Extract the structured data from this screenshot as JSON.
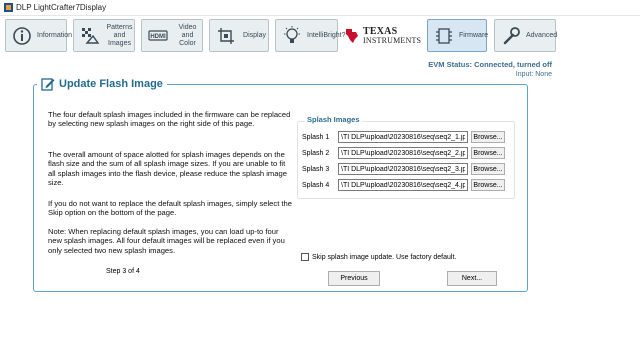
{
  "window": {
    "title": "DLP LightCrafter7Display"
  },
  "toolbar": {
    "information": "Information",
    "patterns": "Patterns and Images",
    "video": "Video and Color",
    "display": "Display",
    "intellibright": "IntelliBright?",
    "brand_line1": "Texas",
    "brand_line2": "Instruments",
    "firmware": "Firmware",
    "advanced": "Advanced",
    "hdmi_badge": "HDMI"
  },
  "status": {
    "evm": "EVM Status: Connected, turned off",
    "input": "Input: None"
  },
  "panel": {
    "title": "Update Flash Image",
    "p1": "The four default splash images included in the firmware can be replaced by selecting new splash images on the right side of this page.",
    "p2": "The overall amount of space alotted for splash images depends on the flash size and the sum of all splash image sizes. If you are unable to fit all splash images into the flash device, please reduce the splash image size.",
    "p3": "If you do not want to replace the default splash images, simply select the Skip option on the bottom of the page.",
    "p4": "Note: When replacing default splash images, you can load up-to four new splash images. All four default images will be replaced even if you only selected two new splash images.",
    "step": "Step 3 of 4"
  },
  "splash": {
    "group_title": "Splash Images",
    "browse": "Browse...",
    "rows": [
      {
        "label": "Splash 1",
        "value": "\\TI DLP\\upload\\20230816\\seq\\seq2_1.jpg"
      },
      {
        "label": "Splash 2",
        "value": "\\TI DLP\\upload\\20230816\\seq\\seq2_2.jpg"
      },
      {
        "label": "Splash 3",
        "value": "\\TI DLP\\upload\\20230816\\seq\\seq2_3.jpg"
      },
      {
        "label": "Splash 4",
        "value": "\\TI DLP\\upload\\20230816\\seq\\seq2_4.jpg"
      }
    ],
    "skip_label": "Skip splash image update. Use factory default.",
    "skip_checked": false
  },
  "nav": {
    "previous": "Previous",
    "next": "Next..."
  }
}
